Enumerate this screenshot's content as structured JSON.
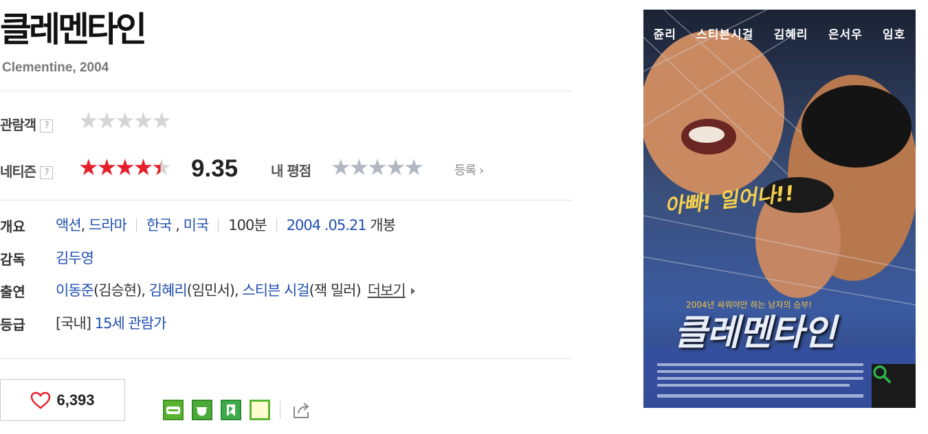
{
  "title": "클레멘타인",
  "subtitle": "Clementine, 2004",
  "audience": {
    "label": "관람객",
    "help": "?",
    "stars": "★★★★★"
  },
  "netizen": {
    "label": "네티즌",
    "help": "?",
    "stars_full": "★★★★",
    "star_half": "★",
    "score": "9.35"
  },
  "my_rating": {
    "label": "내 평점",
    "stars": "★★★★★",
    "register": "등록"
  },
  "info": {
    "overview_label": "개요",
    "genres": [
      "액션",
      "드라마"
    ],
    "countries": [
      "한국",
      "미국"
    ],
    "runtime": "100분",
    "release_date": "2004 .05.21",
    "release_suffix": "개봉",
    "director_label": "감독",
    "director": "김두영",
    "cast_label": "출연",
    "cast": [
      {
        "name": "이동준",
        "role": "(김승현)"
      },
      {
        "name": "김혜리",
        "role": "(임민서)"
      },
      {
        "name": "스티븐 시걸",
        "role": "(잭 밀러)"
      }
    ],
    "more": "더보기",
    "rating_label": "등급",
    "rating_prefix": "[국내]",
    "rating": "15세 관람가"
  },
  "like_count": "6,393",
  "share_icons": [
    "blog-icon",
    "cafe-icon",
    "bookmark-icon",
    "memo-icon",
    "share-icon"
  ],
  "poster": {
    "cast": [
      "쥰리",
      "스티븐시걸",
      "김혜리",
      "은서우",
      "임호"
    ],
    "shout": "아빠! 일어나!!",
    "tagline": "2004년 싸워야만 하는 남자의 승부!",
    "title": "클레멘타인"
  },
  "colors": {
    "star_red": "#e4202c",
    "link_blue": "#1f4fb0",
    "zoom_green": "#2fb34a"
  }
}
